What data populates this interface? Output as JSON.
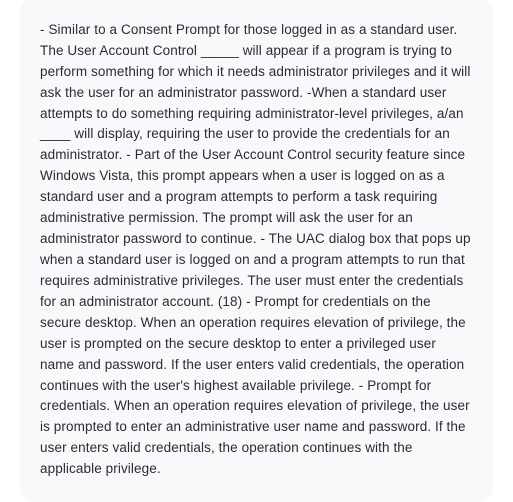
{
  "card": {
    "body": "- Similar to a Consent Prompt for those logged in as a standard user. The User Account Control _____ will appear if a program is trying to perform something for which it needs administrator privileges and it will ask the user for an administrator password. -When a standard user attempts to do something requiring administrator-level privileges, a/an ____ will display, requiring the user to provide the credentials for an administrator. - Part of the User Account Control security feature since Windows Vista, this prompt appears when a user is logged on as a standard user and a program attempts to perform a task requiring administrative permission. The prompt will ask the user for an administrator password to continue. - The UAC dialog box that pops up when a standard user is logged on and a program attempts to run that requires administrative privileges. The user must enter the credentials for an administrator account. (18) - Prompt for credentials on the secure desktop. When an operation requires elevation of privilege, the user is prompted on the secure desktop to enter a privileged user name and password. If the user enters valid credentials, the operation continues with the user's highest available privilege. - Prompt for credentials. When an operation requires elevation of privilege, the user is prompted to enter an administrative user name and password. If the user enters valid credentials, the operation continues with the applicable privilege."
  }
}
